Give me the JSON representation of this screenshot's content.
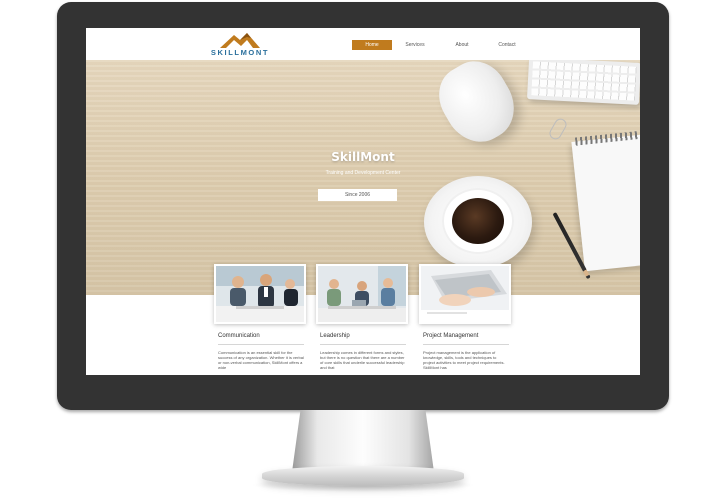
{
  "site": {
    "logo_text": "SKILLMONT",
    "nav": [
      {
        "label": "Home",
        "active": true
      },
      {
        "label": "Services",
        "active": false
      },
      {
        "label": "About",
        "active": false
      },
      {
        "label": "Contact",
        "active": false
      }
    ]
  },
  "hero": {
    "title": "SkillMont",
    "subtitle": "Training and Development Center",
    "badge": "Since 2006"
  },
  "cards": [
    {
      "title": "Communication",
      "text": "Communication is an essential skill for the success of any organization. Whether it is verbal or non-verbal communication, SkillMont offers a wide"
    },
    {
      "title": "Leadership",
      "text": "Leadership comes in different forms and styles, but there is no question that there are a number of core skills that underlie successful leadership and that"
    },
    {
      "title": "Project Management",
      "text": "Project management is the application of knowledge, skills, tools and techniques to project activities to meet project requirements. SkillMont has"
    }
  ],
  "colors": {
    "accent": "#c07b1e",
    "logo_blue": "#2a6f9c",
    "bezel": "#333333"
  }
}
